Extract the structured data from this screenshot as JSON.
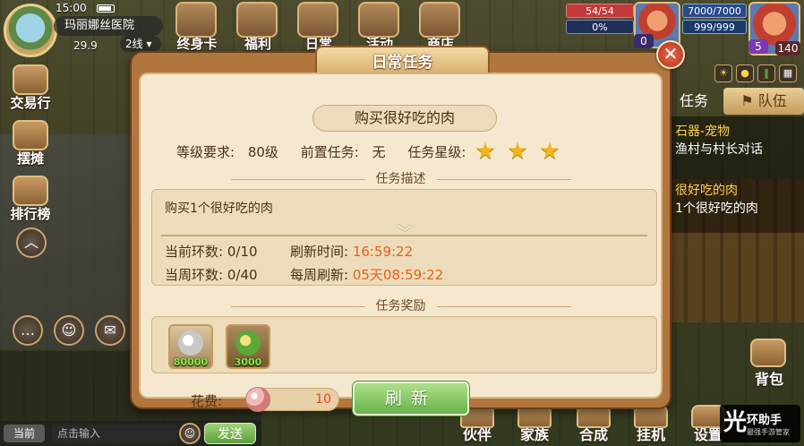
{
  "hud": {
    "time": "15:00",
    "location": "玛丽娜丝医院",
    "coord": "29.9",
    "line": "2线",
    "top_icons": [
      "终身卡",
      "福利",
      "日常",
      "活动",
      "商店"
    ],
    "side_buttons": [
      "交易行",
      "摆摊",
      "排行榜"
    ],
    "pet_hp": "54/54",
    "pet_mp": "0%",
    "pet_level": "0",
    "player_hp": "7000/7000",
    "player_mp": "999/999",
    "player_level": "140",
    "player_rank": "5"
  },
  "task_panel": {
    "tabs": [
      "任务",
      "队伍"
    ],
    "items": [
      {
        "title": "石器-宠物",
        "desc": "渔村与村长对话"
      },
      {
        "title": "很好吃的肉",
        "desc": "1个很好吃的肉"
      }
    ]
  },
  "chat": {
    "channel": "当前",
    "input_placeholder": "点击输入",
    "send_label": "发送"
  },
  "bottom_buttons": [
    "伙伴",
    "家族",
    "合成",
    "挂机",
    "设置"
  ],
  "bag_label": "背包",
  "watermark": {
    "brand": "环助手",
    "mark": "光",
    "sub": "最强手游管家"
  },
  "dialog": {
    "title": "日常任务",
    "close_label": "✕",
    "task_name": "购买很好吃的肉",
    "level_req_label": "等级要求:",
    "level_req": "80级",
    "prereq_label": "前置任务:",
    "prereq": "无",
    "stars_label": "任务星级:",
    "stars": 3,
    "desc_section": "任务描述",
    "desc_text": "购买1个很好吃的肉",
    "current_rounds_label": "当前环数:",
    "current_rounds": "0/10",
    "refresh_time_label": "刷新时间:",
    "refresh_time": "16:59:22",
    "week_rounds_label": "当周环数:",
    "week_rounds": "0/40",
    "weekly_refresh_label": "每周刷新:",
    "weekly_refresh": "05天08:59:22",
    "reward_section": "任务奖励",
    "rewards": [
      {
        "name": "银币",
        "qty": "80000"
      },
      {
        "name": "经验",
        "qty": "3000"
      }
    ],
    "cost_label": "花费:",
    "cost_value": "10",
    "refresh_button": "刷新"
  },
  "colors": {
    "accent_orange": "#e2621a",
    "button_green": "#6ab34a",
    "panel_bg": "#f5e8cf",
    "frame": "#b0763e"
  }
}
